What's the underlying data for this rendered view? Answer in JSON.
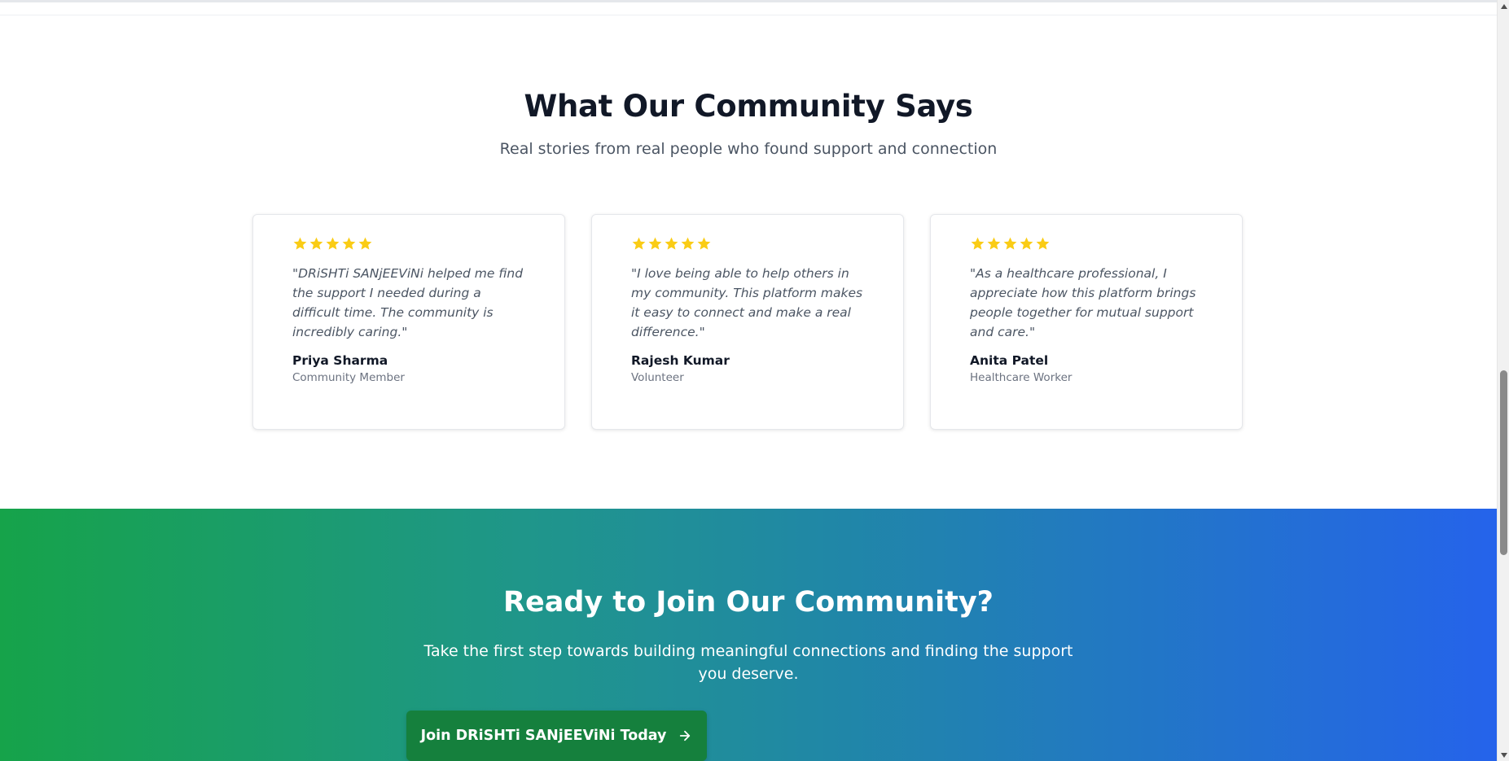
{
  "testimonials": {
    "title": "What Our Community Says",
    "subtitle": "Real stories from real people who found support and connection",
    "items": [
      {
        "rating": 5,
        "quote": "\"DRiSHTi SANjEEViNi helped me find the support I needed during a difficult time. The community is incredibly caring.\"",
        "name": "Priya Sharma",
        "role": "Community Member"
      },
      {
        "rating": 5,
        "quote": "\"I love being able to help others in my community. This platform makes it easy to connect and make a real difference.\"",
        "name": "Rajesh Kumar",
        "role": "Volunteer"
      },
      {
        "rating": 5,
        "quote": "\"As a healthcare professional, I appreciate how this platform brings people together for mutual support and care.\"",
        "name": "Anita Patel",
        "role": "Healthcare Worker"
      }
    ]
  },
  "cta": {
    "title": "Ready to Join Our Community?",
    "text": "Take the first step towards building meaningful connections and finding the support you deserve.",
    "button_label": "Join DRiSHTi SANjEEViNi Today",
    "button_icon": "arrow-right-icon"
  },
  "colors": {
    "star": "#facc15",
    "cta_gradient_start": "#16a34a",
    "cta_gradient_end": "#2563eb",
    "button_bg": "#15803d"
  }
}
